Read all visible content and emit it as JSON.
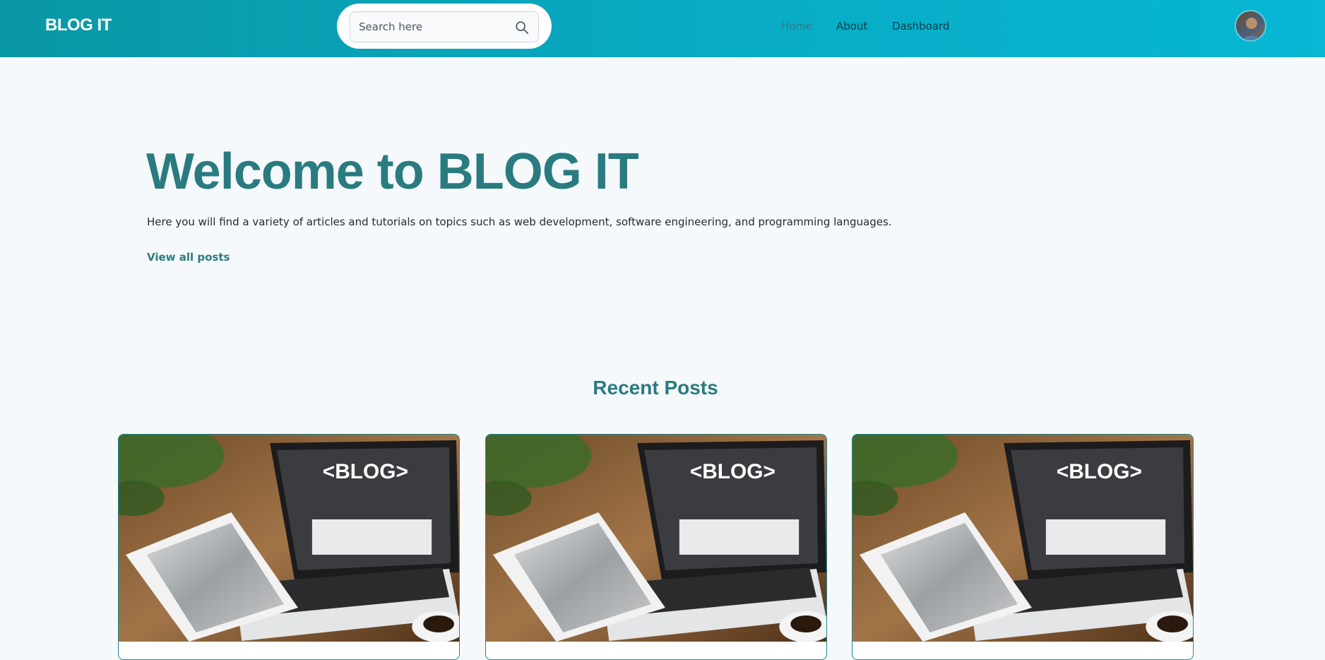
{
  "header": {
    "brand": "BLOG IT",
    "search": {
      "placeholder": "Search here",
      "value": ""
    },
    "nav": [
      {
        "label": "Home",
        "active": true
      },
      {
        "label": "About",
        "active": false
      },
      {
        "label": "Dashboard",
        "active": false
      }
    ],
    "icons": {
      "search": "search-icon",
      "theme_toggle": "moon-icon",
      "avatar": "avatar"
    }
  },
  "hero": {
    "title": "Welcome to BLOG IT",
    "subtitle": "Here you will find a variety of articles and tutorials on topics such as web development, software engineering, and programming languages.",
    "cta": "View all posts"
  },
  "recent_posts": {
    "title": "Recent Posts",
    "cards": [
      {
        "image_text": "<BLOG>"
      },
      {
        "image_text": "<BLOG>"
      },
      {
        "image_text": "<BLOG>"
      }
    ]
  },
  "colors": {
    "header_gradient_start": "#0a97a4",
    "header_gradient_end": "#07b7d3",
    "accent": "#2a7b80",
    "page_background": "#f5f9fc"
  }
}
